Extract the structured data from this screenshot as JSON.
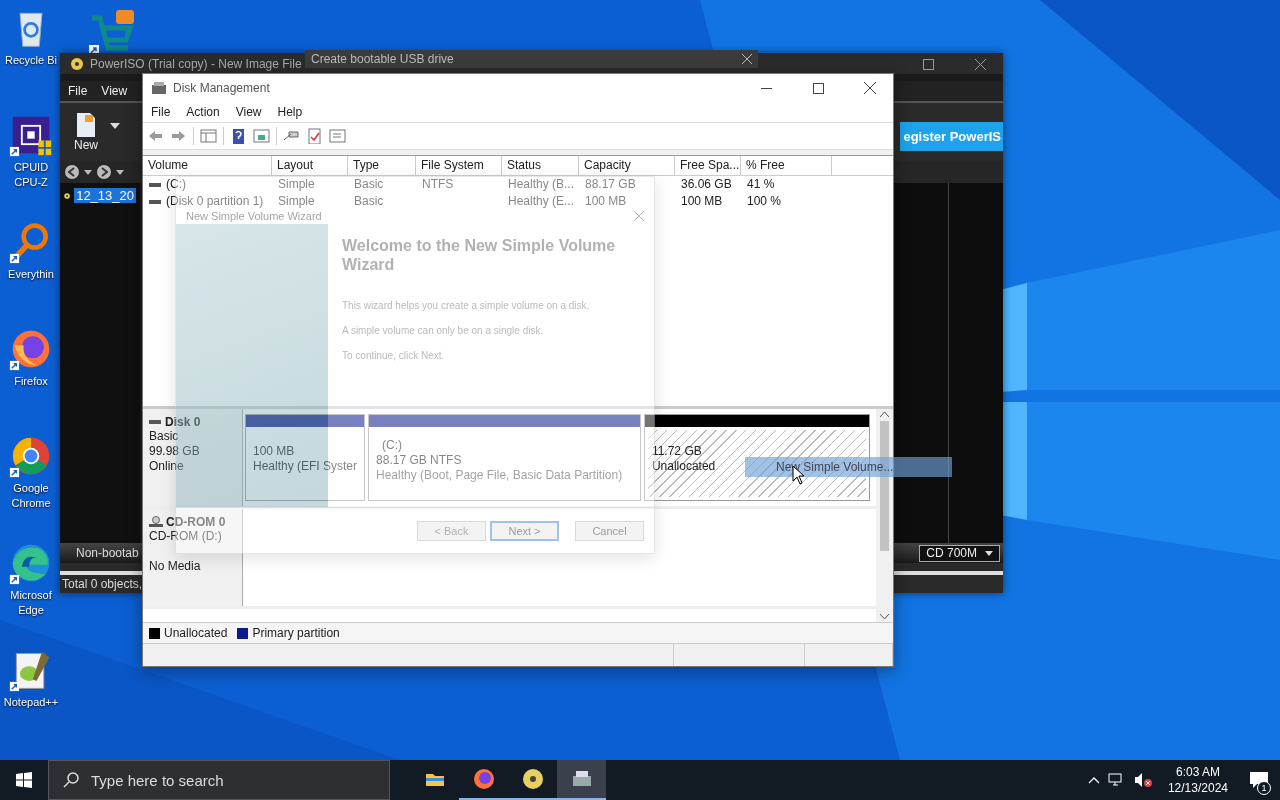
{
  "desktop": {
    "icons": [
      {
        "kind": "recycle-bin",
        "label": [
          "Recycle Bi"
        ]
      },
      {
        "kind": "cpu-chip",
        "label": [
          "CPUID",
          "CPU-Z"
        ]
      },
      {
        "kind": "magnifier",
        "label": [
          "Everythin"
        ]
      },
      {
        "kind": "firefox",
        "label": [
          "Firefox"
        ]
      },
      {
        "kind": "chrome",
        "label": [
          "Google",
          "Chrome"
        ]
      },
      {
        "kind": "edge",
        "label": [
          "Microsof",
          "Edge"
        ]
      },
      {
        "kind": "notepad",
        "label": [
          "Notepad++"
        ]
      }
    ],
    "extra_icon": {
      "kind": "cart"
    }
  },
  "usb_window": {
    "title": "Create bootable USB drive"
  },
  "poweriso": {
    "title": "PowerISO (Trial copy) - New Image File",
    "menu": [
      "File",
      "View"
    ],
    "new_button": "New",
    "banner": "egister PowerIS",
    "tree": [
      {
        "label": "12_13_20",
        "selected": true
      }
    ],
    "boot_status": "Non-bootab",
    "media": "CD 700M",
    "status": "Total 0 objects,"
  },
  "disk_management": {
    "title": "Disk Management",
    "menu": [
      "File",
      "Action",
      "View",
      "Help"
    ],
    "table": {
      "columns": [
        "Volume",
        "Layout",
        "Type",
        "File System",
        "Status",
        "Capacity",
        "Free Spa...",
        "% Free"
      ],
      "rows": [
        [
          "(C:)",
          "Simple",
          "Basic",
          "NTFS",
          "Healthy (B...",
          "88.17 GB",
          "36.06 GB",
          "41 %"
        ],
        [
          "(Disk 0 partition 1)",
          "Simple",
          "Basic",
          null,
          "Healthy (E...",
          "100 MB",
          "100 MB",
          "100 %"
        ]
      ]
    },
    "disks": [
      {
        "kind": "hdd",
        "name": "Disk 0",
        "lines": [
          "Basic",
          "99.98 GB",
          "Online"
        ],
        "partitions": [
          {
            "kind": "primary",
            "lines": [
              "100 MB",
              "Healthy (EFI Syster"
            ]
          },
          {
            "kind": "primary",
            "lines": [
              "(C:)",
              "88.17 GB NTFS",
              "Healthy (Boot, Page File, Basic Data Partition)"
            ]
          },
          {
            "kind": "unallocated",
            "lines": [
              "11.72 GB",
              "Unallocated"
            ]
          }
        ]
      },
      {
        "kind": "cdrom",
        "name": "CD-ROM 0",
        "lines": [
          "CD-ROM (D:)",
          "No Media"
        ]
      }
    ],
    "legend": [
      {
        "label": "Unallocated",
        "color": "#000000"
      },
      {
        "label": "Primary partition",
        "color": "#0d1a8c"
      }
    ]
  },
  "wizard": {
    "title": "New Simple Volume Wizard",
    "heading": "Welcome to the New Simple Volume Wizard",
    "paragraphs": [
      "This wizard helps you create a simple volume on a disk.",
      "A simple volume can only be on a single disk.",
      "To continue, click Next."
    ],
    "buttons": [
      {
        "label": "< Back",
        "disabled": true,
        "default": false
      },
      {
        "label": "Next >",
        "disabled": false,
        "default": true
      },
      {
        "label": "Cancel",
        "disabled": false,
        "default": false
      }
    ]
  },
  "context_menu": {
    "items": [
      {
        "label": "New Simple Volume...",
        "selected": true
      }
    ]
  },
  "taskbar": {
    "search_placeholder": "Type here to search",
    "apps": [
      {
        "kind": "folder",
        "running": false,
        "selected": false
      },
      {
        "kind": "firefox",
        "running": true,
        "selected": false
      },
      {
        "kind": "disc",
        "running": true,
        "selected": false
      },
      {
        "kind": "disk-manager",
        "running": true,
        "selected": true
      }
    ],
    "time": "6:03 AM",
    "date": "12/13/2024",
    "notifications": "1"
  }
}
